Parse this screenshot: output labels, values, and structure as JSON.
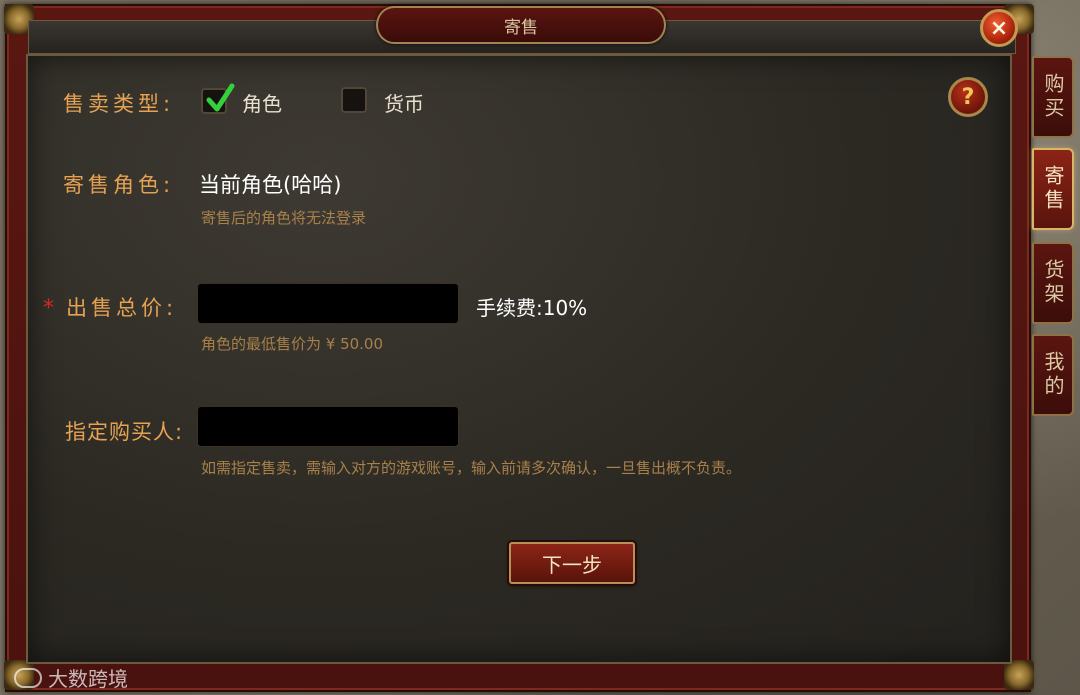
{
  "window": {
    "title": "寄售"
  },
  "side_tabs": [
    {
      "label": "购买",
      "active": false
    },
    {
      "label": "寄售",
      "active": true
    },
    {
      "label": "货架",
      "active": false
    },
    {
      "label": "我的",
      "active": false
    }
  ],
  "sale_type": {
    "label": "售卖类型:",
    "options": [
      {
        "label": "角色",
        "checked": true
      },
      {
        "label": "货币",
        "checked": false
      }
    ]
  },
  "consign_role": {
    "label": "寄售角色:",
    "value": "当前角色(哈哈)",
    "hint": "寄售后的角色将无法登录"
  },
  "total_price": {
    "required_mark": "*",
    "label": "出售总价:",
    "value": "",
    "fee_label": "手续费:10%",
    "hint": "角色的最低售价为 ¥ 50.00"
  },
  "buyer": {
    "label": "指定购买人:",
    "value": "",
    "hint": "如需指定售卖，需输入对方的游戏账号，输入前请多次确认，一旦售出概不负责。"
  },
  "next_button": {
    "label": "下一步"
  },
  "watermark": {
    "text": "大数跨境"
  },
  "icons": {
    "close": "×",
    "help": "?"
  }
}
